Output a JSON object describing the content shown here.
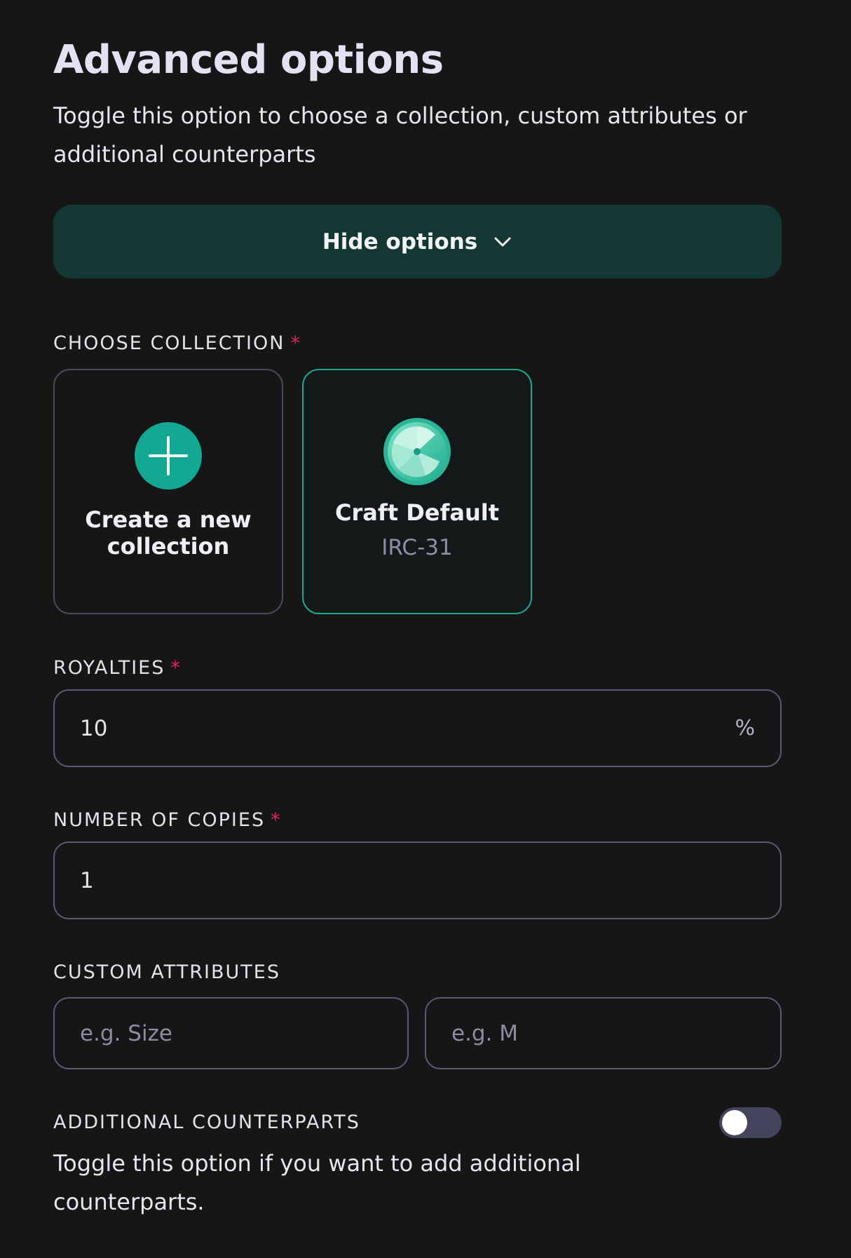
{
  "header": {
    "title": "Advanced options",
    "subtitle": "Toggle this option to choose a collection, custom attributes or additional counterparts"
  },
  "hide_button": {
    "label": "Hide options",
    "icon": "chevron-down-icon"
  },
  "choose_collection": {
    "label": "CHOOSE COLLECTION",
    "required_mark": "*",
    "cards": [
      {
        "title": "Create a new collection",
        "icon": "plus-icon",
        "selected": false
      },
      {
        "title": "Craft Default",
        "subtitle": "IRC-31",
        "icon": "collection-logo-icon",
        "selected": true
      }
    ]
  },
  "royalties": {
    "label": "ROYALTIES",
    "required_mark": "*",
    "value": "10",
    "suffix": "%"
  },
  "copies": {
    "label": "NUMBER OF COPIES",
    "required_mark": "*",
    "value": "1"
  },
  "custom_attributes": {
    "label": "CUSTOM ATTRIBUTES",
    "key_placeholder": "e.g. Size",
    "value_placeholder": "e.g. M"
  },
  "counterparts": {
    "label": "ADDITIONAL COUNTERPARTS",
    "toggle_on": false,
    "description": "Toggle this option if you want to add additional counterparts."
  },
  "colors": {
    "background": "#161617",
    "accent": "#18a88f",
    "button_bg": "#133834",
    "required": "#e2245a",
    "border": "#5a5a74"
  }
}
